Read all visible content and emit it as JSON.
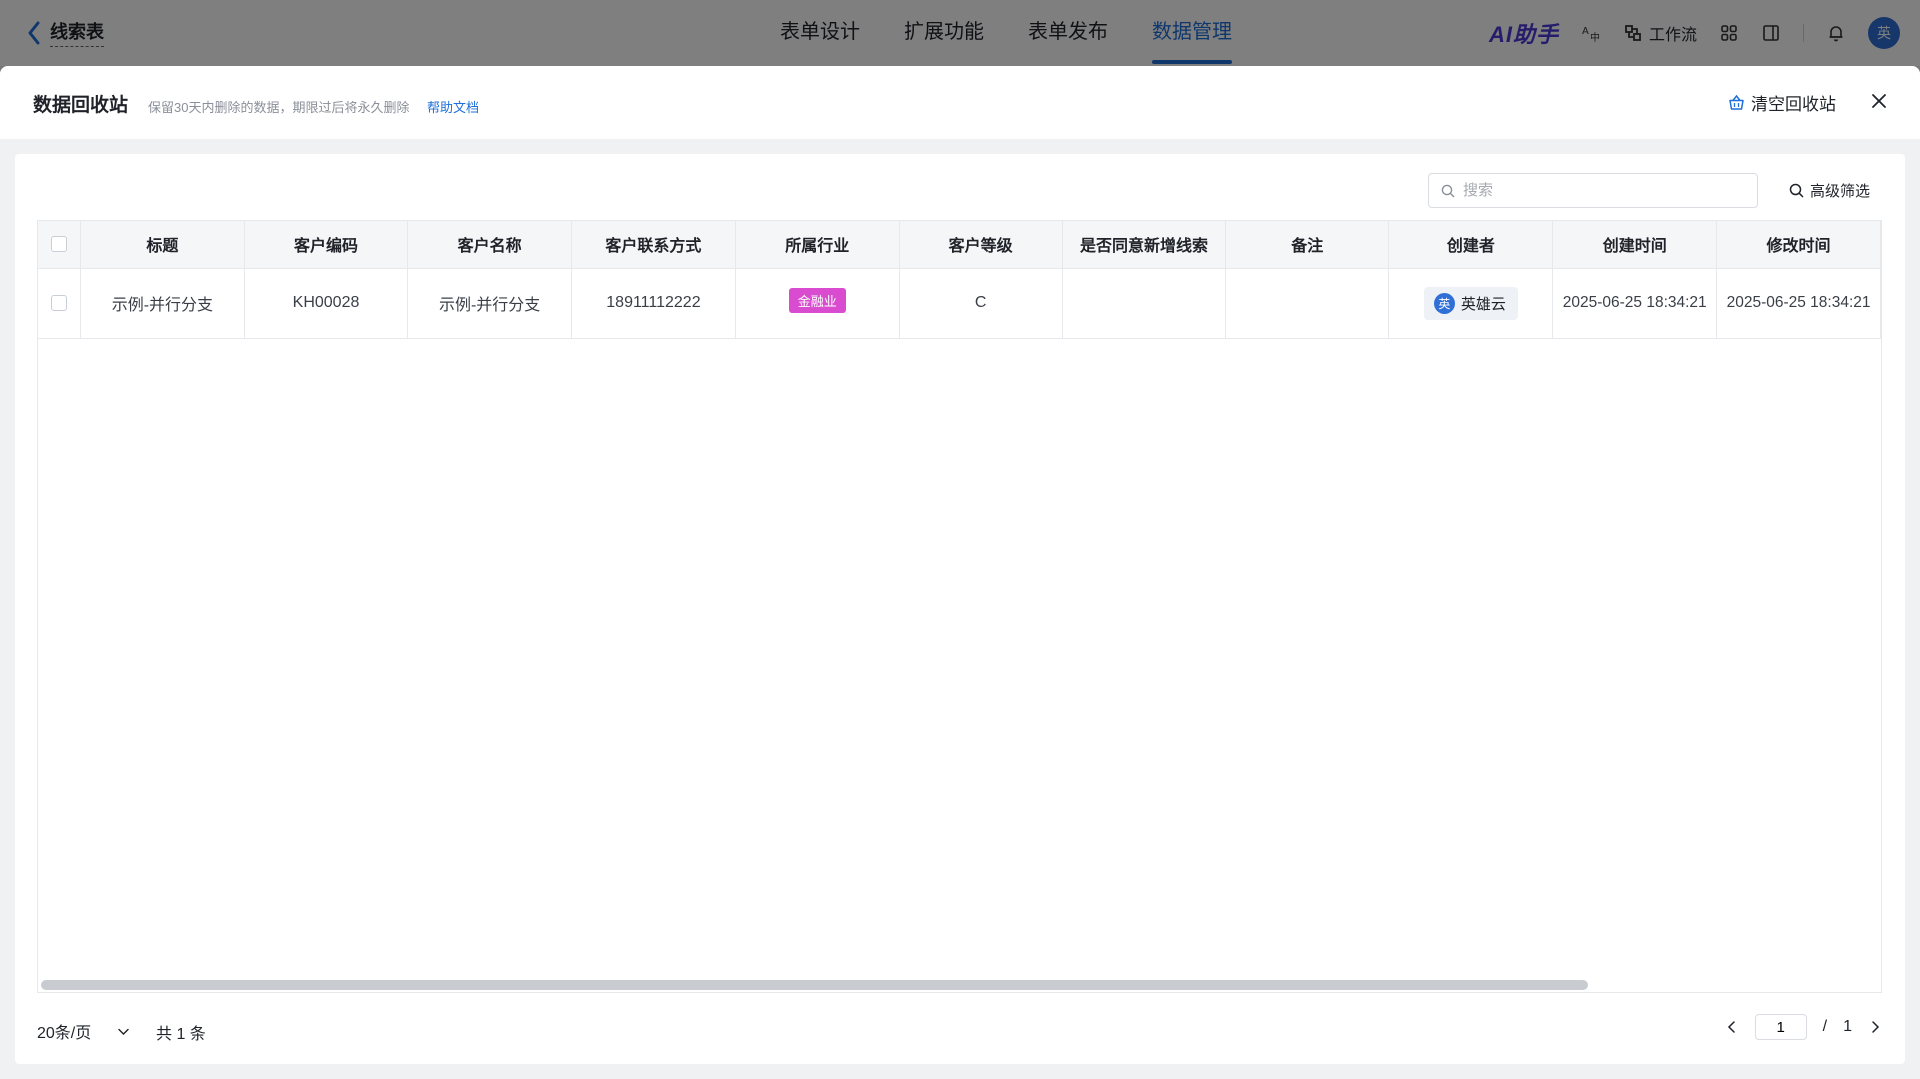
{
  "header": {
    "back_title": "线索表",
    "tabs": [
      {
        "label": "表单设计"
      },
      {
        "label": "扩展功能"
      },
      {
        "label": "表单发布"
      },
      {
        "label": "数据管理"
      }
    ],
    "active_tab": "数据管理",
    "ai_label": "AI助手",
    "workflow_label": "工作流",
    "user_avatar": "英"
  },
  "drawer": {
    "title": "数据回收站",
    "description": "保留30天内删除的数据，期限过后将永久删除",
    "help_link": "帮助文档",
    "clear_label": "清空回收站"
  },
  "toolbar": {
    "search_placeholder": "搜索",
    "adv_filter_label": "高级筛选"
  },
  "table": {
    "columns": [
      "标题",
      "客户编码",
      "客户名称",
      "客户联系方式",
      "所属行业",
      "客户等级",
      "是否同意新增线索",
      "备注",
      "创建者",
      "创建时间",
      "修改时间"
    ],
    "rows": [
      {
        "title": "示例-并行分支",
        "code": "KH00028",
        "name": "示例-并行分支",
        "phone": "18911112222",
        "industry": "金融业",
        "level": "C",
        "agree": "",
        "remark": "",
        "creator": "英雄云",
        "creator_avatar": "英",
        "created": "2025-06-25 18:34:21",
        "modified": "2025-06-25 18:34:21"
      }
    ]
  },
  "footer": {
    "page_size": "20条/页",
    "total": "共 1 条",
    "current_page": "1",
    "separator": "/",
    "total_pages": "1"
  },
  "colors": {
    "accent": "#1e6fd9",
    "industry_tag": "#d94ccf",
    "avatar": "#2f6fd6"
  }
}
